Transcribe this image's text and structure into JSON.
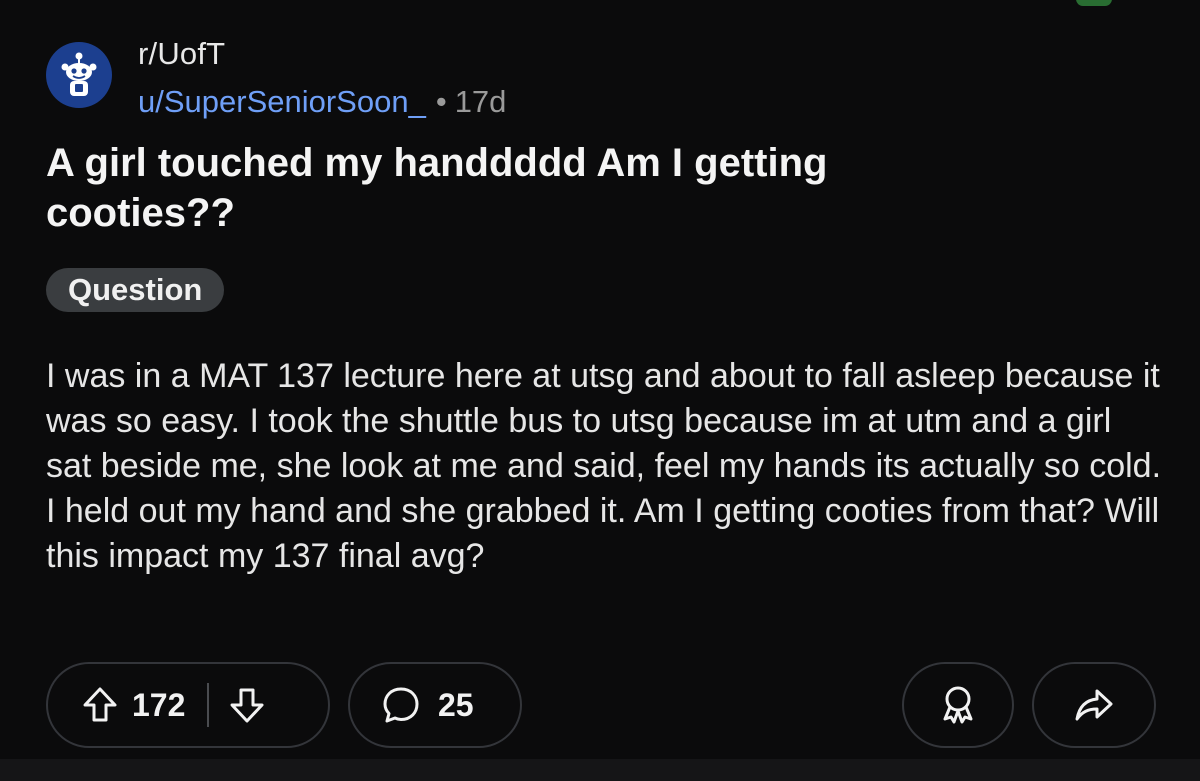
{
  "post": {
    "subreddit": "r/UofT",
    "username": "u/SuperSeniorSoon_",
    "separator": "•",
    "age": "17d",
    "title": "A girl touched my handdddd Am I getting cooties??",
    "flair": "Question",
    "body": "I was in a MAT 137 lecture here at utsg and about to fall asleep because it was so easy. I took the shuttle bus to utsg because im at utm and a girl sat beside me, she look at me and said, feel my hands its actually so cold. I held out my hand and she grabbed it. Am I getting cooties from that? Will this impact my 137 final avg?"
  },
  "actions": {
    "upvotes": "172",
    "comments": "25"
  },
  "icons": {
    "avatar": "snoo-avatar-icon",
    "upvote": "arrow-up-icon",
    "downvote": "arrow-down-icon",
    "comment": "speech-bubble-icon",
    "award": "award-icon",
    "share": "share-arrow-icon"
  },
  "colors": {
    "background": "#0b0b0c",
    "username": "#6f9ff7",
    "flair_bg": "#3a3d40",
    "avatar_bg": "#1c3f8f"
  }
}
